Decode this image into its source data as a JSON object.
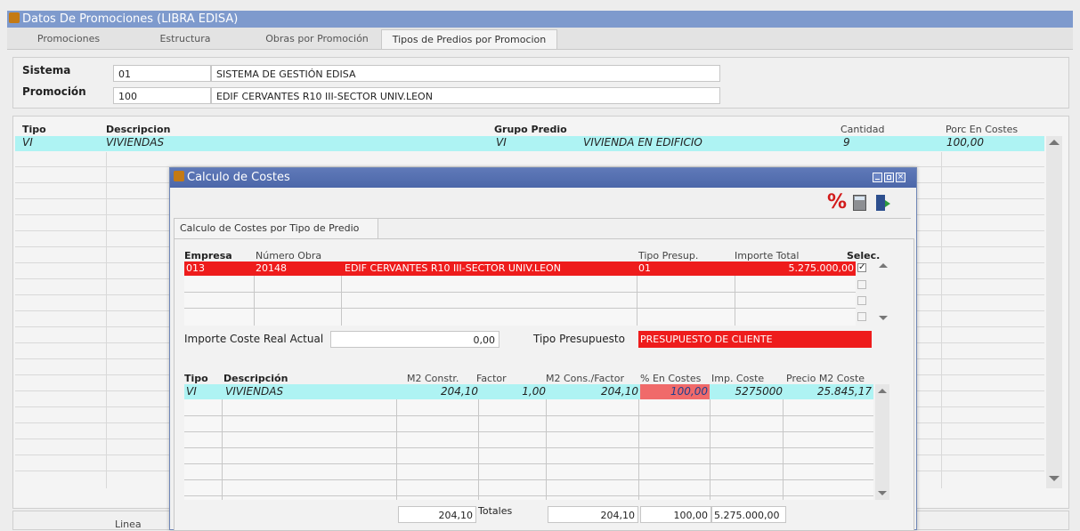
{
  "window": {
    "title": "Datos De Promociones (LIBRA EDISA)",
    "tabs": [
      "Promociones",
      "Estructura",
      "Obras por Promoción",
      "Tipos de Predios por Promocion"
    ]
  },
  "header": {
    "sistema_label": "Sistema",
    "sistema_code": "01",
    "sistema_name": "SISTEMA DE GESTIÓN EDISA",
    "promocion_label": "Promoción",
    "promocion_code": "100",
    "promocion_name": "EDIF CERVANTES R10 III-SECTOR UNIV.LEON"
  },
  "grid": {
    "columns": {
      "tipo": "Tipo",
      "descripcion": "Descripcion",
      "grupo": "Grupo Predio",
      "cantidad": "Cantidad",
      "porc": "Porc En Costes"
    },
    "row": {
      "tipo": "VI",
      "descripcion": "VIVIENDAS",
      "grupo_code": "VI",
      "grupo_name": "VIVIENDA EN EDIFICIO",
      "cantidad": "9",
      "porc": "100,00"
    }
  },
  "footer": {
    "lineas_label": "Linea"
  },
  "dialog": {
    "title": "Calculo de Costes",
    "toolbar_icons": [
      "percent-icon",
      "calculator-icon",
      "exit-door-icon"
    ],
    "tab": "Calculo de Costes por Tipo de Predio",
    "obras": {
      "columns": {
        "empresa": "Empresa",
        "obra": "Número Obra",
        "tipo": "Tipo Presup.",
        "importe": "Importe Total",
        "selec": "Selec."
      },
      "row": {
        "empresa": "013",
        "obra": "20148",
        "descripcion": "EDIF CERVANTES R10 III-SECTOR UNIV.LEON",
        "tipo": "01",
        "importe": "5.275.000,00",
        "selected": true
      }
    },
    "importe_label": "Importe Coste Real Actual",
    "importe_value": "0,00",
    "tipo_presupuesto_label": "Tipo Presupuesto",
    "tipo_presupuesto_value": "PRESUPUESTO DE CLIENTE",
    "costes": {
      "columns": {
        "tipo": "Tipo",
        "descripcion": "Descripción",
        "m2": "M2 Constr.",
        "factor": "Factor",
        "m2f": "M2 Cons./Factor",
        "pct": "% En Costes",
        "imp": "Imp. Coste",
        "precio": "Precio M2 Coste"
      },
      "row": {
        "tipo": "VI",
        "descripcion": "VIVIENDAS",
        "m2": "204,10",
        "factor": "1,00",
        "m2f": "204,10",
        "pct": "100,00",
        "imp": "5275000",
        "precio": "25.845,17"
      }
    },
    "totales": {
      "m2": "204,10",
      "label": "Totales",
      "m2f": "204,10",
      "pct": "100,00",
      "imp": "5.275.000,00"
    }
  },
  "colors": {
    "title_bar": "#7e9acd",
    "dialog_title": "#4c67a9",
    "selected_row": "#aef3f3",
    "highlight_red": "#ee1c1c"
  }
}
